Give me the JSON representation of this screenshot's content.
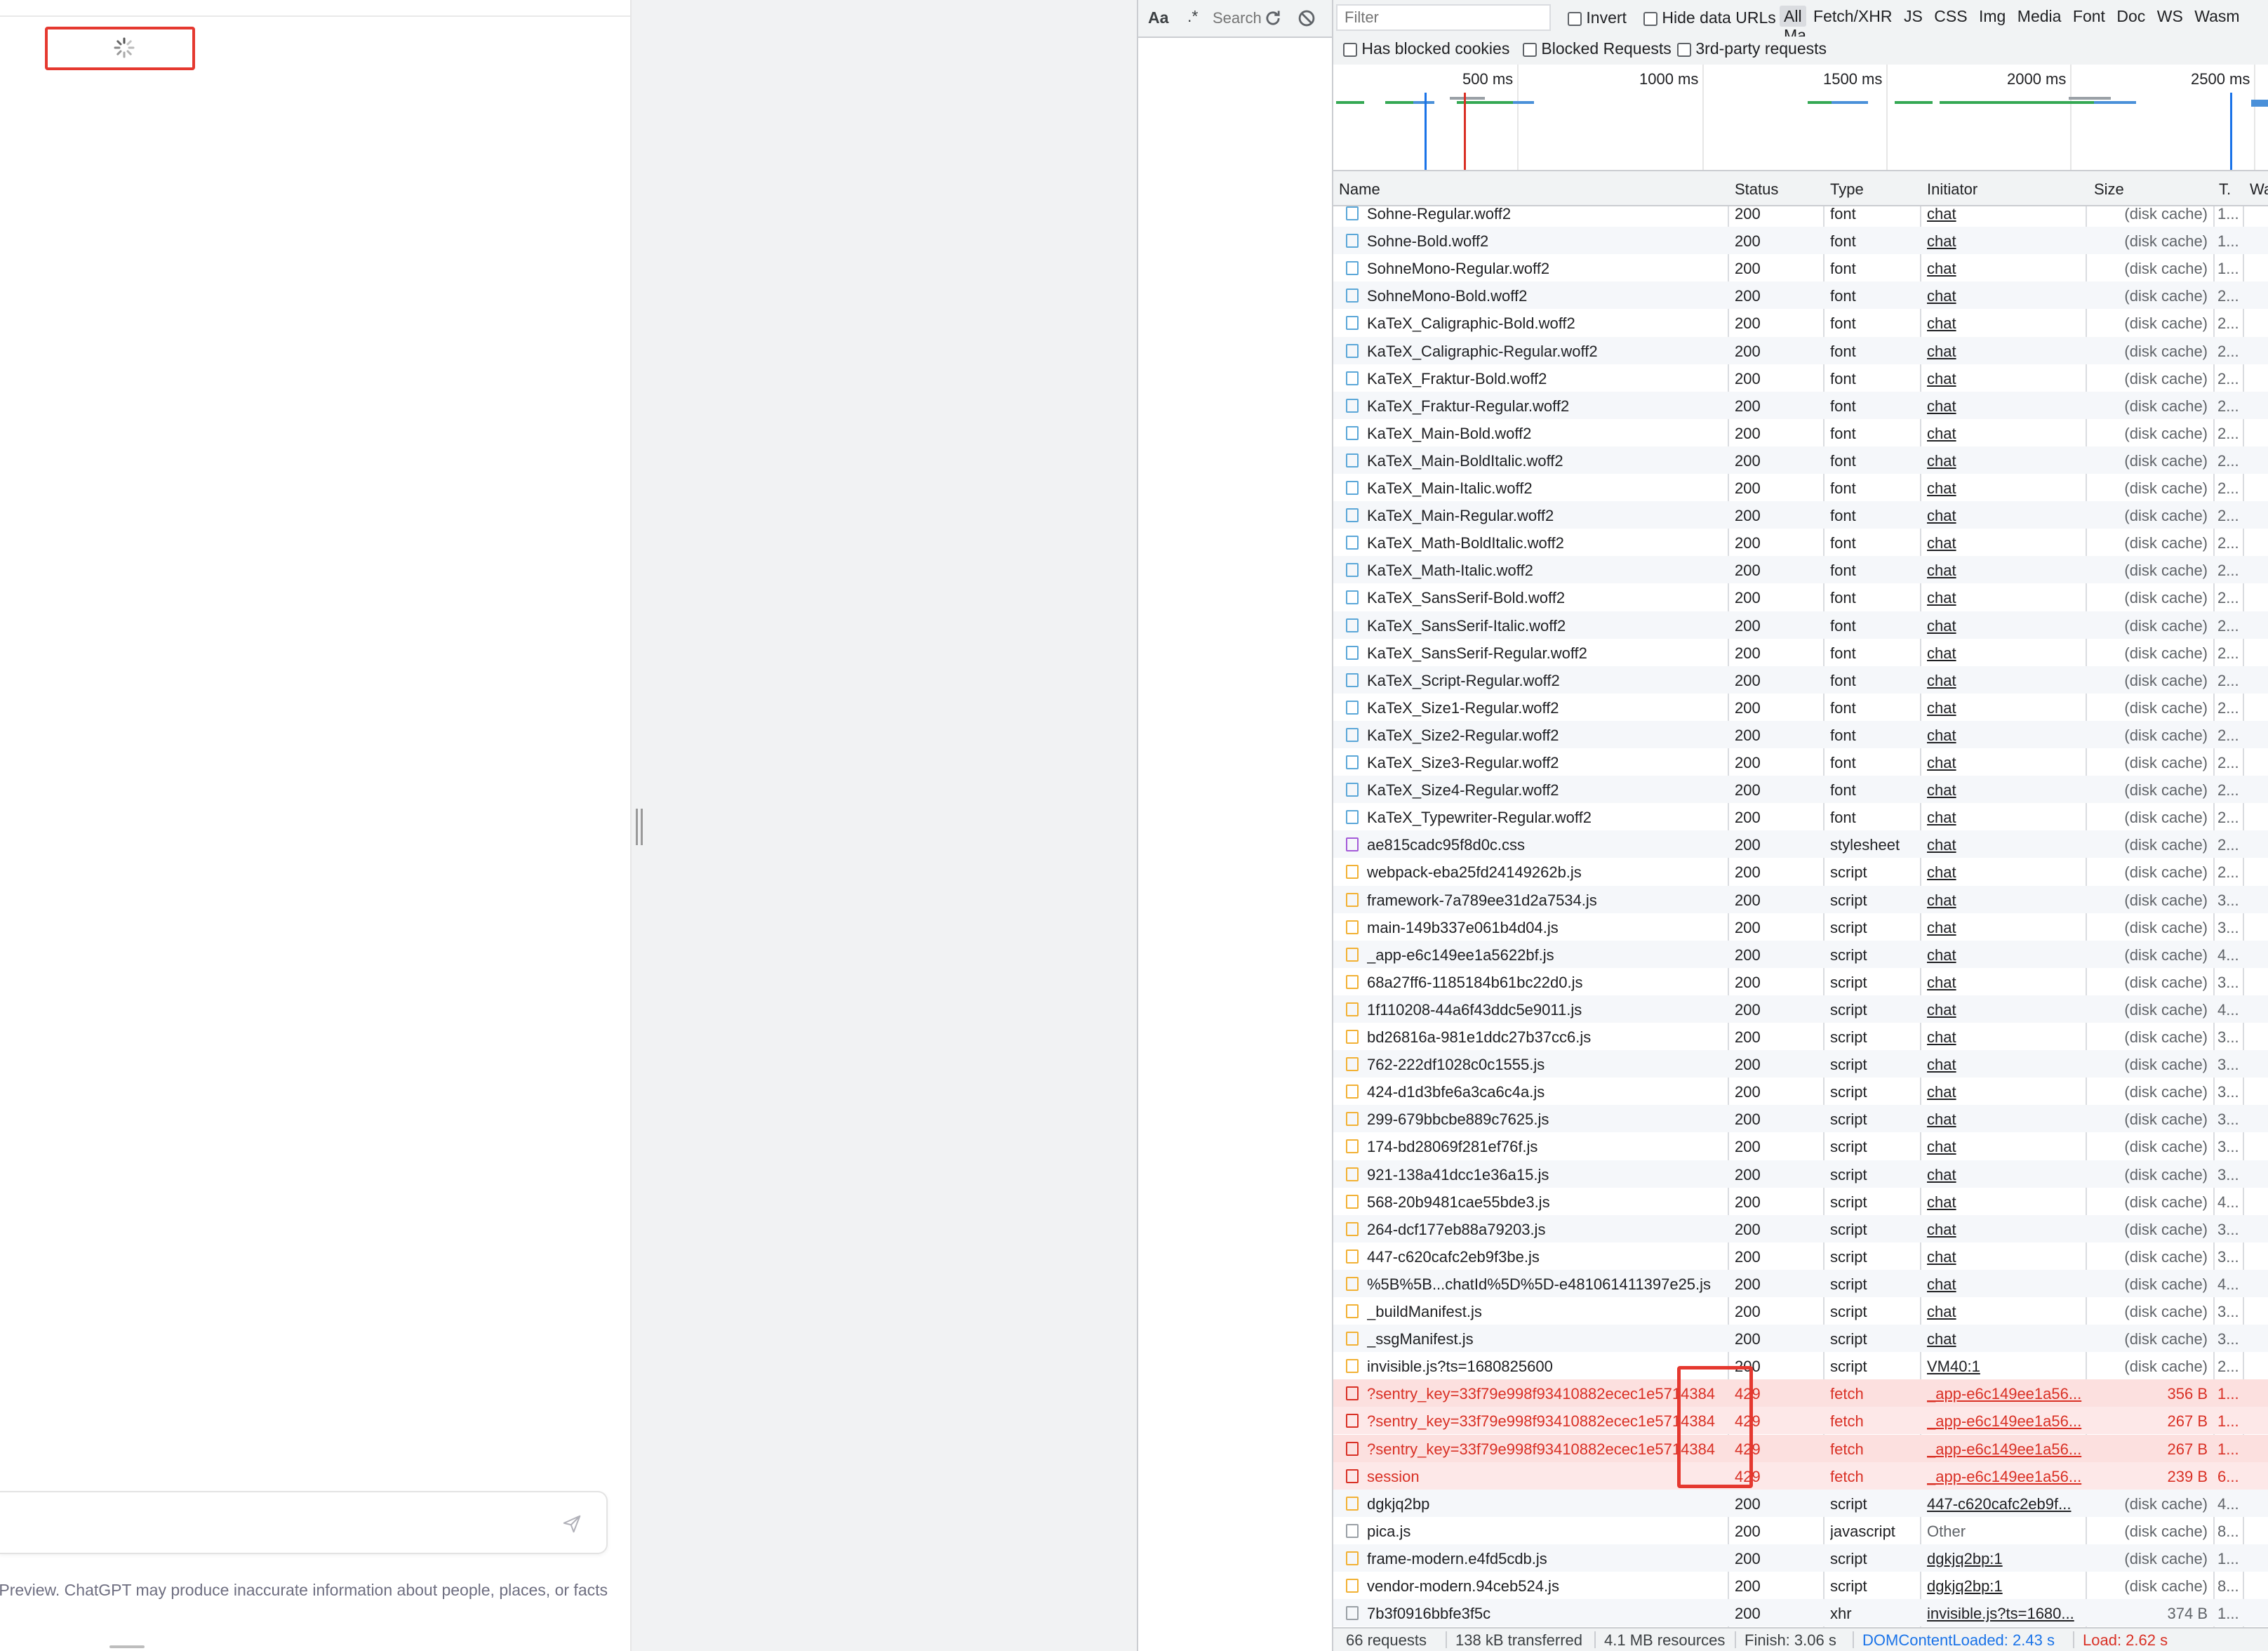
{
  "chat": {
    "disclaimer": "Free Research Preview. ChatGPT may produce inaccurate information about people, places, or facts"
  },
  "devtools": {
    "search": {
      "match_case": "Aa",
      "regex": ".*",
      "placeholder": "Search"
    },
    "filter": {
      "placeholder": "Filter"
    },
    "options": {
      "invert": "Invert",
      "hide_data_urls": "Hide data URLs",
      "has_blocked_cookies": "Has blocked cookies",
      "blocked_requests": "Blocked Requests",
      "third_party": "3rd-party requests"
    },
    "types": [
      "All",
      "Fetch/XHR",
      "JS",
      "CSS",
      "Img",
      "Media",
      "Font",
      "Doc",
      "WS",
      "Wasm",
      "Ma"
    ],
    "overview_labels": [
      "500 ms",
      "1000 ms",
      "1500 ms",
      "2000 ms",
      "2500 ms"
    ],
    "columns": {
      "name": "Name",
      "status": "Status",
      "type": "Type",
      "initiator": "Initiator",
      "size": "Size",
      "time": "T.",
      "waterfall": "Waterfall"
    },
    "rows": [
      {
        "name": "Sohne-Regular.woff2",
        "status": "200",
        "type": "font",
        "initiator": "chat",
        "size": "(disk cache)",
        "time": "1..."
      },
      {
        "name": "Sohne-Bold.woff2",
        "status": "200",
        "type": "font",
        "initiator": "chat",
        "size": "(disk cache)",
        "time": "1..."
      },
      {
        "name": "SohneMono-Regular.woff2",
        "status": "200",
        "type": "font",
        "initiator": "chat",
        "size": "(disk cache)",
        "time": "1..."
      },
      {
        "name": "SohneMono-Bold.woff2",
        "status": "200",
        "type": "font",
        "initiator": "chat",
        "size": "(disk cache)",
        "time": "2..."
      },
      {
        "name": "KaTeX_Caligraphic-Bold.woff2",
        "status": "200",
        "type": "font",
        "initiator": "chat",
        "size": "(disk cache)",
        "time": "2..."
      },
      {
        "name": "KaTeX_Caligraphic-Regular.woff2",
        "status": "200",
        "type": "font",
        "initiator": "chat",
        "size": "(disk cache)",
        "time": "2..."
      },
      {
        "name": "KaTeX_Fraktur-Bold.woff2",
        "status": "200",
        "type": "font",
        "initiator": "chat",
        "size": "(disk cache)",
        "time": "2..."
      },
      {
        "name": "KaTeX_Fraktur-Regular.woff2",
        "status": "200",
        "type": "font",
        "initiator": "chat",
        "size": "(disk cache)",
        "time": "2..."
      },
      {
        "name": "KaTeX_Main-Bold.woff2",
        "status": "200",
        "type": "font",
        "initiator": "chat",
        "size": "(disk cache)",
        "time": "2..."
      },
      {
        "name": "KaTeX_Main-BoldItalic.woff2",
        "status": "200",
        "type": "font",
        "initiator": "chat",
        "size": "(disk cache)",
        "time": "2..."
      },
      {
        "name": "KaTeX_Main-Italic.woff2",
        "status": "200",
        "type": "font",
        "initiator": "chat",
        "size": "(disk cache)",
        "time": "2..."
      },
      {
        "name": "KaTeX_Main-Regular.woff2",
        "status": "200",
        "type": "font",
        "initiator": "chat",
        "size": "(disk cache)",
        "time": "2..."
      },
      {
        "name": "KaTeX_Math-BoldItalic.woff2",
        "status": "200",
        "type": "font",
        "initiator": "chat",
        "size": "(disk cache)",
        "time": "2..."
      },
      {
        "name": "KaTeX_Math-Italic.woff2",
        "status": "200",
        "type": "font",
        "initiator": "chat",
        "size": "(disk cache)",
        "time": "2..."
      },
      {
        "name": "KaTeX_SansSerif-Bold.woff2",
        "status": "200",
        "type": "font",
        "initiator": "chat",
        "size": "(disk cache)",
        "time": "2..."
      },
      {
        "name": "KaTeX_SansSerif-Italic.woff2",
        "status": "200",
        "type": "font",
        "initiator": "chat",
        "size": "(disk cache)",
        "time": "2..."
      },
      {
        "name": "KaTeX_SansSerif-Regular.woff2",
        "status": "200",
        "type": "font",
        "initiator": "chat",
        "size": "(disk cache)",
        "time": "2..."
      },
      {
        "name": "KaTeX_Script-Regular.woff2",
        "status": "200",
        "type": "font",
        "initiator": "chat",
        "size": "(disk cache)",
        "time": "2..."
      },
      {
        "name": "KaTeX_Size1-Regular.woff2",
        "status": "200",
        "type": "font",
        "initiator": "chat",
        "size": "(disk cache)",
        "time": "2..."
      },
      {
        "name": "KaTeX_Size2-Regular.woff2",
        "status": "200",
        "type": "font",
        "initiator": "chat",
        "size": "(disk cache)",
        "time": "2..."
      },
      {
        "name": "KaTeX_Size3-Regular.woff2",
        "status": "200",
        "type": "font",
        "initiator": "chat",
        "size": "(disk cache)",
        "time": "2..."
      },
      {
        "name": "KaTeX_Size4-Regular.woff2",
        "status": "200",
        "type": "font",
        "initiator": "chat",
        "size": "(disk cache)",
        "time": "2..."
      },
      {
        "name": "KaTeX_Typewriter-Regular.woff2",
        "status": "200",
        "type": "font",
        "initiator": "chat",
        "size": "(disk cache)",
        "time": "2..."
      },
      {
        "name": "ae815cadc95f8d0c.css",
        "status": "200",
        "type": "stylesheet",
        "initiator": "chat",
        "size": "(disk cache)",
        "time": "2..."
      },
      {
        "name": "webpack-eba25fd24149262b.js",
        "status": "200",
        "type": "script",
        "initiator": "chat",
        "size": "(disk cache)",
        "time": "2..."
      },
      {
        "name": "framework-7a789ee31d2a7534.js",
        "status": "200",
        "type": "script",
        "initiator": "chat",
        "size": "(disk cache)",
        "time": "3..."
      },
      {
        "name": "main-149b337e061b4d04.js",
        "status": "200",
        "type": "script",
        "initiator": "chat",
        "size": "(disk cache)",
        "time": "3..."
      },
      {
        "name": "_app-e6c149ee1a5622bf.js",
        "status": "200",
        "type": "script",
        "initiator": "chat",
        "size": "(disk cache)",
        "time": "4..."
      },
      {
        "name": "68a27ff6-1185184b61bc22d0.js",
        "status": "200",
        "type": "script",
        "initiator": "chat",
        "size": "(disk cache)",
        "time": "3..."
      },
      {
        "name": "1f110208-44a6f43ddc5e9011.js",
        "status": "200",
        "type": "script",
        "initiator": "chat",
        "size": "(disk cache)",
        "time": "4..."
      },
      {
        "name": "bd26816a-981e1ddc27b37cc6.js",
        "status": "200",
        "type": "script",
        "initiator": "chat",
        "size": "(disk cache)",
        "time": "3..."
      },
      {
        "name": "762-222df1028c0c1555.js",
        "status": "200",
        "type": "script",
        "initiator": "chat",
        "size": "(disk cache)",
        "time": "3..."
      },
      {
        "name": "424-d1d3bfe6a3ca6c4a.js",
        "status": "200",
        "type": "script",
        "initiator": "chat",
        "size": "(disk cache)",
        "time": "3..."
      },
      {
        "name": "299-679bbcbe889c7625.js",
        "status": "200",
        "type": "script",
        "initiator": "chat",
        "size": "(disk cache)",
        "time": "3..."
      },
      {
        "name": "174-bd28069f281ef76f.js",
        "status": "200",
        "type": "script",
        "initiator": "chat",
        "size": "(disk cache)",
        "time": "3..."
      },
      {
        "name": "921-138a41dcc1e36a15.js",
        "status": "200",
        "type": "script",
        "initiator": "chat",
        "size": "(disk cache)",
        "time": "3..."
      },
      {
        "name": "568-20b9481cae55bde3.js",
        "status": "200",
        "type": "script",
        "initiator": "chat",
        "size": "(disk cache)",
        "time": "4..."
      },
      {
        "name": "264-dcf177eb88a79203.js",
        "status": "200",
        "type": "script",
        "initiator": "chat",
        "size": "(disk cache)",
        "time": "3..."
      },
      {
        "name": "447-c620cafc2eb9f3be.js",
        "status": "200",
        "type": "script",
        "initiator": "chat",
        "size": "(disk cache)",
        "time": "3..."
      },
      {
        "name": "%5B%5B...chatId%5D%5D-e481061411397e25.js",
        "status": "200",
        "type": "script",
        "initiator": "chat",
        "size": "(disk cache)",
        "time": "4..."
      },
      {
        "name": "_buildManifest.js",
        "status": "200",
        "type": "script",
        "initiator": "chat",
        "size": "(disk cache)",
        "time": "3..."
      },
      {
        "name": "_ssgManifest.js",
        "status": "200",
        "type": "script",
        "initiator": "chat",
        "size": "(disk cache)",
        "time": "3..."
      },
      {
        "name": "invisible.js?ts=1680825600",
        "status": "200",
        "type": "script",
        "initiator": "VM40:1",
        "size": "(disk cache)",
        "time": "2..."
      },
      {
        "name": "?sentry_key=33f79e998f93410882ecec1e5714384",
        "status": "429",
        "type": "fetch",
        "initiator": "_app-e6c149ee1a56...",
        "size": "356 B",
        "time": "1...",
        "error": true
      },
      {
        "name": "?sentry_key=33f79e998f93410882ecec1e5714384",
        "status": "429",
        "type": "fetch",
        "initiator": "_app-e6c149ee1a56...",
        "size": "267 B",
        "time": "1...",
        "error": true
      },
      {
        "name": "?sentry_key=33f79e998f93410882ecec1e5714384",
        "status": "429",
        "type": "fetch",
        "initiator": "_app-e6c149ee1a56...",
        "size": "267 B",
        "time": "1...",
        "error": true
      },
      {
        "name": "session",
        "status": "429",
        "type": "fetch",
        "initiator": "_app-e6c149ee1a56...",
        "size": "239 B",
        "time": "6...",
        "error": true
      },
      {
        "name": "dgkjq2bp",
        "status": "200",
        "type": "script",
        "initiator": "447-c620cafc2eb9f...",
        "size": "(disk cache)",
        "time": "4..."
      },
      {
        "name": "pica.js",
        "status": "200",
        "type": "javascript",
        "initiator": "Other",
        "size": "(disk cache)",
        "time": "8...",
        "plain": true
      },
      {
        "name": "frame-modern.e4fd5cdb.js",
        "status": "200",
        "type": "script",
        "initiator": "dgkjq2bp:1",
        "size": "(disk cache)",
        "time": "1..."
      },
      {
        "name": "vendor-modern.94ceb524.js",
        "status": "200",
        "type": "script",
        "initiator": "dgkjq2bp:1",
        "size": "(disk cache)",
        "time": "8..."
      },
      {
        "name": "7b3f0916bbfe3f5c",
        "status": "200",
        "type": "xhr",
        "initiator": "invisible.js?ts=1680...",
        "size": "374 B",
        "time": "1..."
      }
    ],
    "statusbar": {
      "requests": "66 requests",
      "transferred": "138 kB transferred",
      "resources": "4.1 MB resources",
      "finish": "Finish: 3.06 s",
      "dom": "DOMContentLoaded: 2.43 s",
      "load": "Load: 2.62 s"
    },
    "colors": {
      "error": "#d93025",
      "highlight": "#e5382f",
      "dom_content_loaded": "#1a73e8",
      "load": "#d93025"
    }
  }
}
